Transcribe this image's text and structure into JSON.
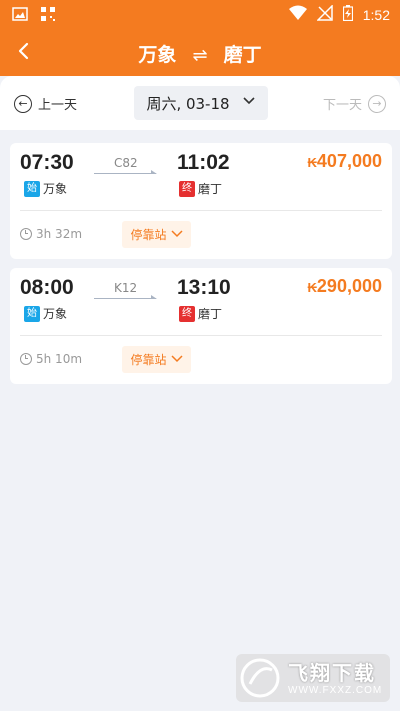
{
  "status_bar": {
    "time": "1:52",
    "left_icons": [
      "image-icon",
      "qr-grid-icon"
    ],
    "right_icons": [
      "wifi-icon",
      "no-signal-icon",
      "battery-charging-icon"
    ]
  },
  "header": {
    "from": "万象",
    "swap_symbol": "⇌",
    "to": "磨丁",
    "background_color": "#f47b20"
  },
  "date_bar": {
    "prev_label": "上一天",
    "next_label": "下一天",
    "selected_date": "周六, 03-18"
  },
  "trains": [
    {
      "train_no": "C82",
      "depart_time": "07:30",
      "arrive_time": "11:02",
      "depart_station": "万象",
      "arrive_station": "磨丁",
      "start_badge": "始",
      "end_badge": "终",
      "currency": "₭",
      "price": "407,000",
      "duration": "3h 32m",
      "stops_label": "停靠站"
    },
    {
      "train_no": "K12",
      "depart_time": "08:00",
      "arrive_time": "13:10",
      "depart_station": "万象",
      "arrive_station": "磨丁",
      "start_badge": "始",
      "end_badge": "终",
      "currency": "₭",
      "price": "290,000",
      "duration": "5h 10m",
      "stops_label": "停靠站"
    }
  ],
  "watermark": {
    "text": "飞翔下载",
    "url": "WWW.FXXZ.COM"
  },
  "colors": {
    "accent": "#f47b20",
    "start_badge": "#1aa6e8",
    "end_badge": "#e53030"
  }
}
